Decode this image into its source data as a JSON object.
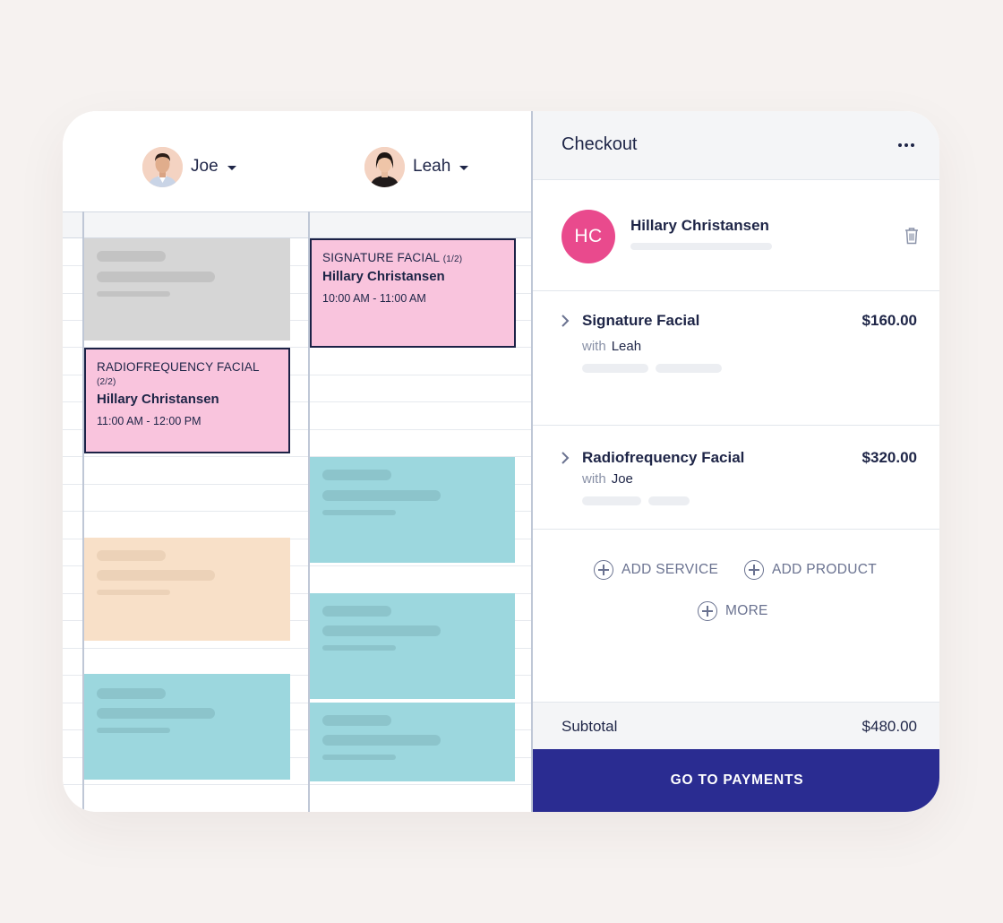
{
  "calendar": {
    "staff": [
      {
        "name": "Joe"
      },
      {
        "name": "Leah"
      }
    ],
    "appointments": [
      {
        "service": "SIGNATURE FACIAL",
        "part": "(1/2)",
        "client": "Hillary Christansen",
        "time": "10:00 AM - 11:00 AM"
      },
      {
        "service": "RADIOFREQUENCY FACIAL",
        "part": "(2/2)",
        "client": "Hillary Christansen",
        "time": "11:00 AM - 12:00 PM"
      }
    ],
    "colors": {
      "grey": "#d6d6d6",
      "pink": "#f9c4dd",
      "peach": "#f8e0c8",
      "teal": "#9cd7de",
      "outline": "#1c2246"
    }
  },
  "checkout": {
    "title": "Checkout",
    "menu_icon": "more-horizontal-icon",
    "client": {
      "initials": "HC",
      "name": "Hillary Christansen",
      "avatar_color": "#e94a8d"
    },
    "services": [
      {
        "name": "Signature Facial",
        "with_label": "with",
        "staff": "Leah",
        "price": "$160.00"
      },
      {
        "name": "Radiofrequency Facial",
        "with_label": "with",
        "staff": "Joe",
        "price": "$320.00"
      }
    ],
    "actions": {
      "add_service": "ADD SERVICE",
      "add_product": "ADD PRODUCT",
      "more": "MORE"
    },
    "subtotal_label": "Subtotal",
    "subtotal_value": "$480.00",
    "pay_button": "GO TO PAYMENTS",
    "pay_color": "#2a2c91"
  }
}
